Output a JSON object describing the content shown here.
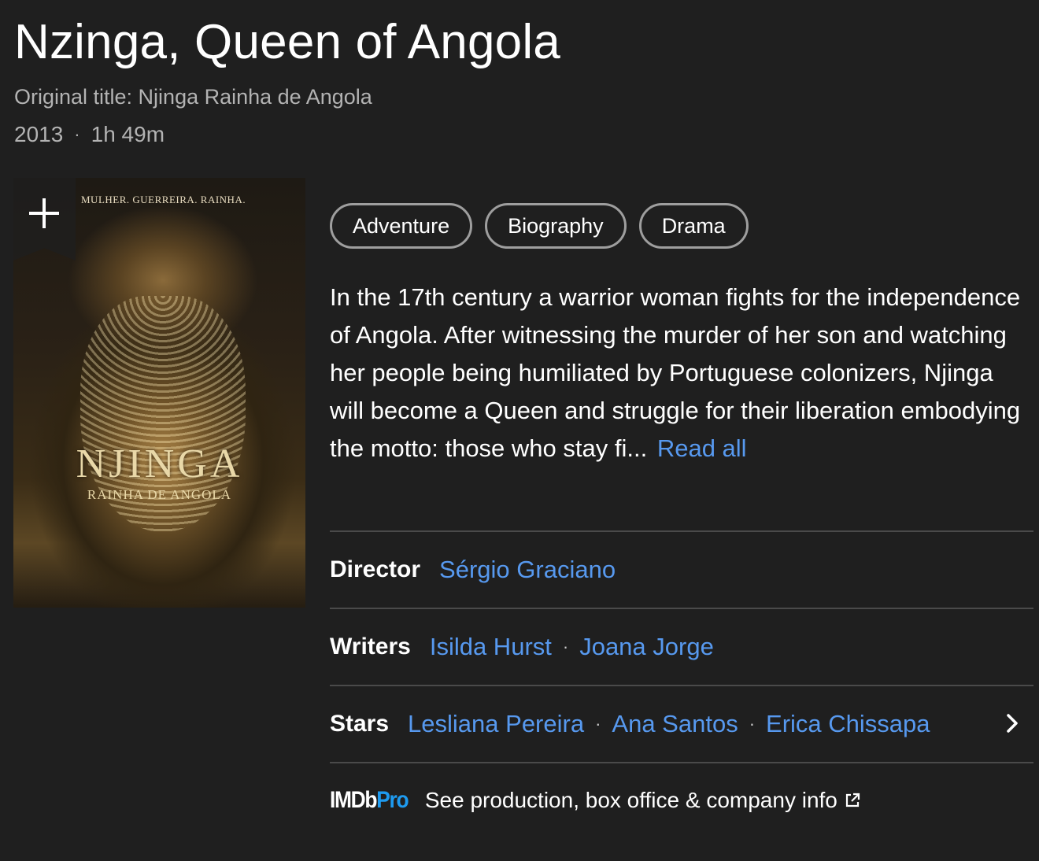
{
  "title": "Nzinga, Queen of Angola",
  "original_title": "Original title: Njinga Rainha de Angola",
  "meta": {
    "year": "2013",
    "separator": "·",
    "runtime": "1h 49m"
  },
  "poster": {
    "tagline": "MULHER. GUERREIRA. RAINHA.",
    "logo": "NJINGA",
    "sublogo": "RAINHA DE ANGOLA",
    "watchlist_icon": "plus-icon"
  },
  "genres": [
    "Adventure",
    "Biography",
    "Drama"
  ],
  "plot": {
    "text": "In the 17th century a warrior woman fights for the independence of Angola. After witnessing the murder of her son and watching her people being humiliated by Portuguese colonizers, Njinga will become a Queen and struggle for their liberation embodying the motto: those who stay fi...",
    "read_all": "Read all"
  },
  "credits": {
    "director": {
      "label": "Director",
      "people": [
        "Sérgio Graciano"
      ]
    },
    "writers": {
      "label": "Writers",
      "people": [
        "Isilda Hurst",
        "Joana Jorge"
      ]
    },
    "stars": {
      "label": "Stars",
      "people": [
        "Lesliana Pereira",
        "Ana Santos",
        "Erica Chissapa"
      ]
    }
  },
  "imdbpro": {
    "logo_a": "IMDb",
    "logo_b": "Pro",
    "text": "See production, box office & company info"
  },
  "colors": {
    "background": "#1f1f1f",
    "link": "#5799ef",
    "pro": "#1e9bf0"
  }
}
